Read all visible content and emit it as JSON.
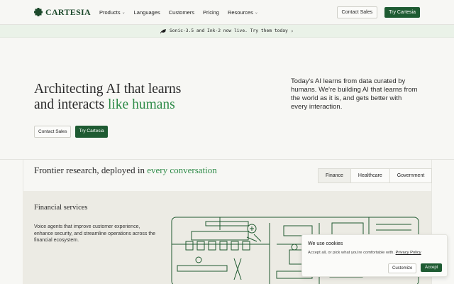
{
  "brand": {
    "name": "CARTESIA",
    "color": "#1e5b32",
    "accent": "#2e8b48"
  },
  "nav": {
    "links": [
      "Products",
      "Languages",
      "Customers",
      "Pricing",
      "Resources"
    ],
    "contact_label": "Contact Sales",
    "try_label": "Try Cartesia"
  },
  "banner": {
    "text": "Sonic-3.5 and Ink-2 now live. Try them today",
    "arrow": "›"
  },
  "hero": {
    "title_line1": "Architecting AI that learns",
    "title_line2_plain": "and interacts ",
    "title_line2_accent": "like humans",
    "contact_label": "Contact Sales",
    "try_label": "Try Cartesia",
    "description": "Today's AI learns from data curated by humans. We're building AI that learns from the world as it is, and gets better with every interaction."
  },
  "research": {
    "title_plain": "Frontier research, deployed in ",
    "title_accent": "every conversation",
    "tabs": [
      "Finance",
      "Healthcare",
      "Government"
    ],
    "active_tab": "Finance",
    "panel_title": "Financial services",
    "panel_description": "Voice agents that improve customer experience, enhance security, and streamline operations across the financial ecosystem."
  },
  "cookies": {
    "title": "We use cookies",
    "text": "Accept all, or pick what you're comfortable with. ",
    "link": "Privacy Policy",
    "customize_label": "Customize",
    "accept_label": "Accept"
  },
  "icons": [
    "cartesia-logo-icon",
    "chevron-down-icon",
    "rocket-icon",
    "chevron-right-icon",
    "office-illustration"
  ]
}
